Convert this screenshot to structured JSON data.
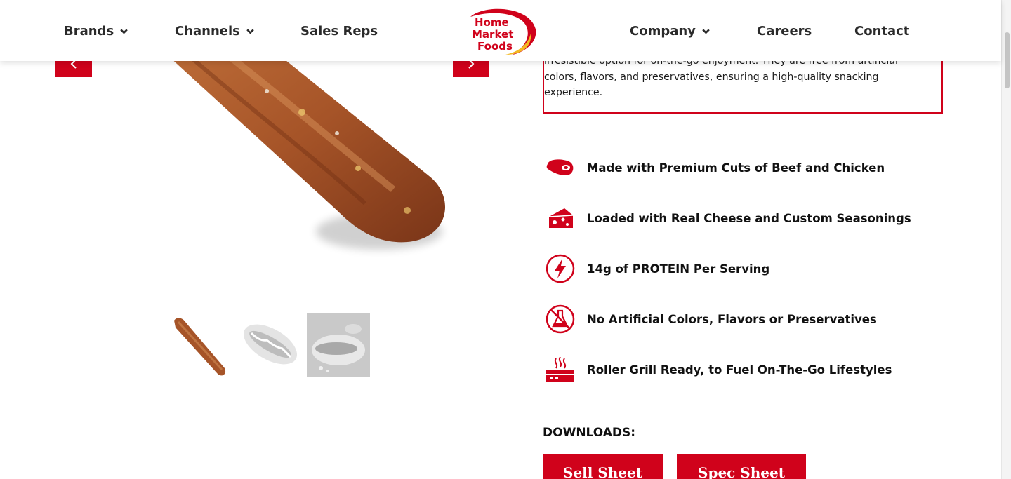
{
  "header": {
    "nav_left": [
      {
        "label": "Brands",
        "has_dropdown": true
      },
      {
        "label": "Channels",
        "has_dropdown": true
      },
      {
        "label": "Sales Reps",
        "has_dropdown": false
      }
    ],
    "nav_right": [
      {
        "label": "Company",
        "has_dropdown": true
      },
      {
        "label": "Careers",
        "has_dropdown": false
      },
      {
        "label": "Contact",
        "has_dropdown": false
      }
    ],
    "logo": {
      "line1": "Home",
      "line2": "Market",
      "line3": "Foods"
    }
  },
  "gallery": {
    "prev_icon": "chevron-left-icon",
    "next_icon": "chevron-right-icon",
    "thumbnails": [
      "grilled-stick-thumb",
      "hot-dog-bun-thumb",
      "plated-hot-dog-thumb"
    ]
  },
  "description": {
    "text": "irresistible option for on-the-go enjoyment. They are free from artificial colors, flavors, and preservatives, ensuring a high-quality snacking experience."
  },
  "features": [
    {
      "icon": "steak-icon",
      "label": "Made with Premium Cuts of Beef and Chicken"
    },
    {
      "icon": "cheese-icon",
      "label": "Loaded with Real Cheese and Custom Seasonings"
    },
    {
      "icon": "lightning-bolt-icon",
      "label": "14g of PROTEIN Per Serving"
    },
    {
      "icon": "no-chemicals-icon",
      "label": "No Artificial Colors, Flavors or Preservatives"
    },
    {
      "icon": "roller-grill-icon",
      "label": "Roller Grill Ready, to Fuel On-The-Go Lifestyles"
    }
  ],
  "downloads": {
    "title": "DOWNLOADS:",
    "sell_sheet": "Sell Sheet",
    "spec_sheet": "Spec Sheet"
  },
  "colors": {
    "brand_red": "#d0021b",
    "brand_yellow": "#f3b821"
  }
}
